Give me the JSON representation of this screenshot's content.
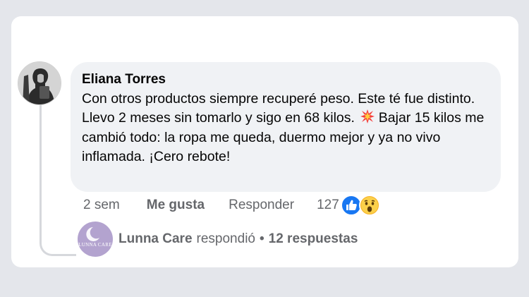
{
  "comment": {
    "author": "Eliana Torres",
    "text": "Con otros productos siempre recuperé peso. Este té fue distinto. Llevo 2 meses sin tomarlo y sigo en 68 kilos.",
    "text_continued": "Bajar 15 kilos me cambió todo: la ropa me queda, duermo mejor y ya no vivo inflamada. ¡Cero rebote!",
    "inline_emoji": "collision-emoji",
    "timestamp": "2 sem",
    "like_label": "Me gusta",
    "reply_label": "Responder",
    "reaction_count": "127",
    "reaction_icons": [
      "like-reaction-icon",
      "wow-reaction-icon"
    ]
  },
  "reply_summary": {
    "author": "Lunna Care",
    "action": "respondió",
    "separator": "•",
    "replies": "12 respuestas",
    "avatar_brand_text": "LUNNA CARE"
  },
  "colors": {
    "background": "#e4e6eb",
    "card": "#ffffff",
    "bubble": "#f0f2f5",
    "secondary_text": "#65676b",
    "like_blue": "#1877f2",
    "wow_yellow": "#f7b125",
    "reply_avatar": "#b3a3cf"
  }
}
